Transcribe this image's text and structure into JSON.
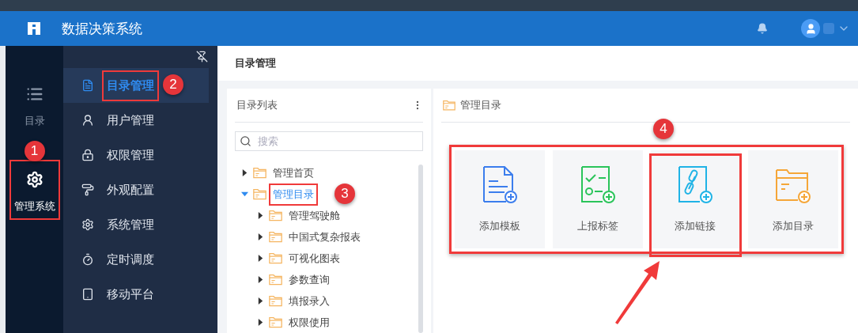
{
  "header": {
    "title": "数据决策系统"
  },
  "rail": [
    {
      "label": "目录",
      "selected": false,
      "highlighted": false
    },
    {
      "label": "管理系统",
      "selected": true,
      "highlighted": true,
      "callout": "1"
    }
  ],
  "menu": [
    {
      "label": "目录管理",
      "selected": true,
      "highlighted": true,
      "callout": "2"
    },
    {
      "label": "用户管理",
      "selected": false,
      "highlighted": false
    },
    {
      "label": "权限管理",
      "selected": false,
      "highlighted": false
    },
    {
      "label": "外观配置",
      "selected": false,
      "highlighted": false
    },
    {
      "label": "系统管理",
      "selected": false,
      "highlighted": false
    },
    {
      "label": "定时调度",
      "selected": false,
      "highlighted": false
    },
    {
      "label": "移动平台",
      "selected": false,
      "highlighted": false
    }
  ],
  "page_title": "目录管理",
  "tree_panel": {
    "title": "目录列表",
    "search": {
      "placeholder": "搜索"
    },
    "nodes": [
      {
        "label": "管理首页",
        "expanded": false,
        "selected": false,
        "highlighted": false
      },
      {
        "label": "管理目录",
        "expanded": true,
        "selected": true,
        "highlighted": true,
        "callout": "3",
        "children": [
          {
            "label": "管理驾驶舱",
            "expanded": false,
            "selected": false,
            "highlighted": false
          },
          {
            "label": "中国式复杂报表",
            "expanded": false,
            "selected": false,
            "highlighted": false
          },
          {
            "label": "可视化图表",
            "expanded": false,
            "selected": false,
            "highlighted": false
          },
          {
            "label": "参数查询",
            "expanded": false,
            "selected": false,
            "highlighted": false
          },
          {
            "label": "填报录入",
            "expanded": false,
            "selected": false,
            "highlighted": false
          },
          {
            "label": "权限使用",
            "expanded": false,
            "selected": false,
            "highlighted": false
          }
        ]
      }
    ]
  },
  "content_panel": {
    "title": "管理目录",
    "callout": "4",
    "highlighted": true,
    "actions": [
      {
        "label": "添加模板",
        "kind": "template",
        "color": "#3b7ded",
        "highlighted": false
      },
      {
        "label": "上报标签",
        "kind": "tag",
        "color": "#2ac45a",
        "highlighted": false
      },
      {
        "label": "添加链接",
        "kind": "link",
        "color": "#1fb3e6",
        "highlighted": true
      },
      {
        "label": "添加目录",
        "kind": "folder",
        "color": "#f5a638",
        "highlighted": false
      }
    ]
  }
}
